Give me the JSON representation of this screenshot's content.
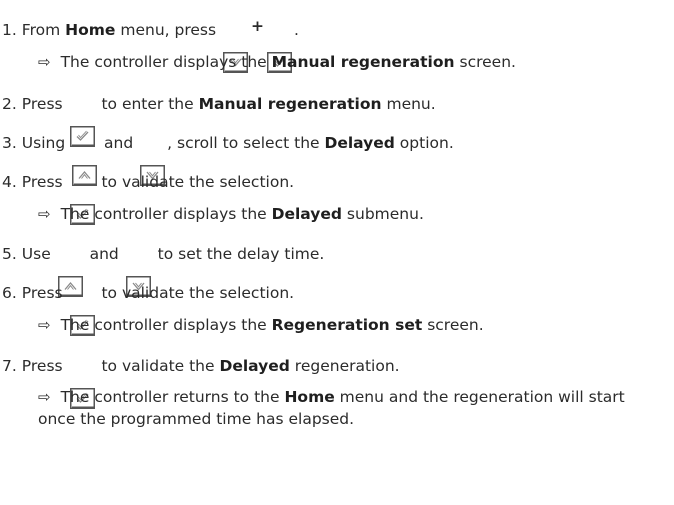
{
  "steps": [
    {
      "num": "1.",
      "t1": "From ",
      "b1": "Home",
      "t2": " menu, press ",
      "t3": "."
    },
    {
      "num": "2.",
      "t1": "Press ",
      "t2": " to enter the ",
      "b1": "Manual regeneration",
      "t3": " menu."
    },
    {
      "num": "3.",
      "t1": "Using ",
      "t2": " and ",
      "t3": ", scroll to select the ",
      "b1": "Delayed",
      "t4": " option."
    },
    {
      "num": "4.",
      "t1": "Press ",
      "t2": " to validate the selection."
    },
    {
      "num": "5.",
      "t1": "Use ",
      "t2": " and ",
      "t3": " to set the delay time."
    },
    {
      "num": "6.",
      "t1": "Press ",
      "t2": " to validate the selection."
    },
    {
      "num": "7.",
      "t1": "Press ",
      "t2": " to validate the ",
      "b1": "Delayed",
      "t3": " regeneration."
    }
  ],
  "results": [
    {
      "t1": "The controller displays the ",
      "b1": "Manual regeneration",
      "t2": " screen."
    },
    {
      "t1": "The controller displays the ",
      "b1": "Delayed",
      "t2": " submenu."
    },
    {
      "t1": "The controller displays the ",
      "b1": "Regeneration set",
      "t2": " screen."
    },
    {
      "t1": "The controller returns to the ",
      "b1": "Home",
      "t2": " menu and the regeneration will start once the programmed time has elapsed."
    }
  ],
  "symbols": {
    "plus": "+",
    "result_arrow": "⇨"
  },
  "icons": {
    "down": "down-arrow-key-icon",
    "up": "up-arrow-key-icon",
    "ok": "validate-key-icon"
  }
}
